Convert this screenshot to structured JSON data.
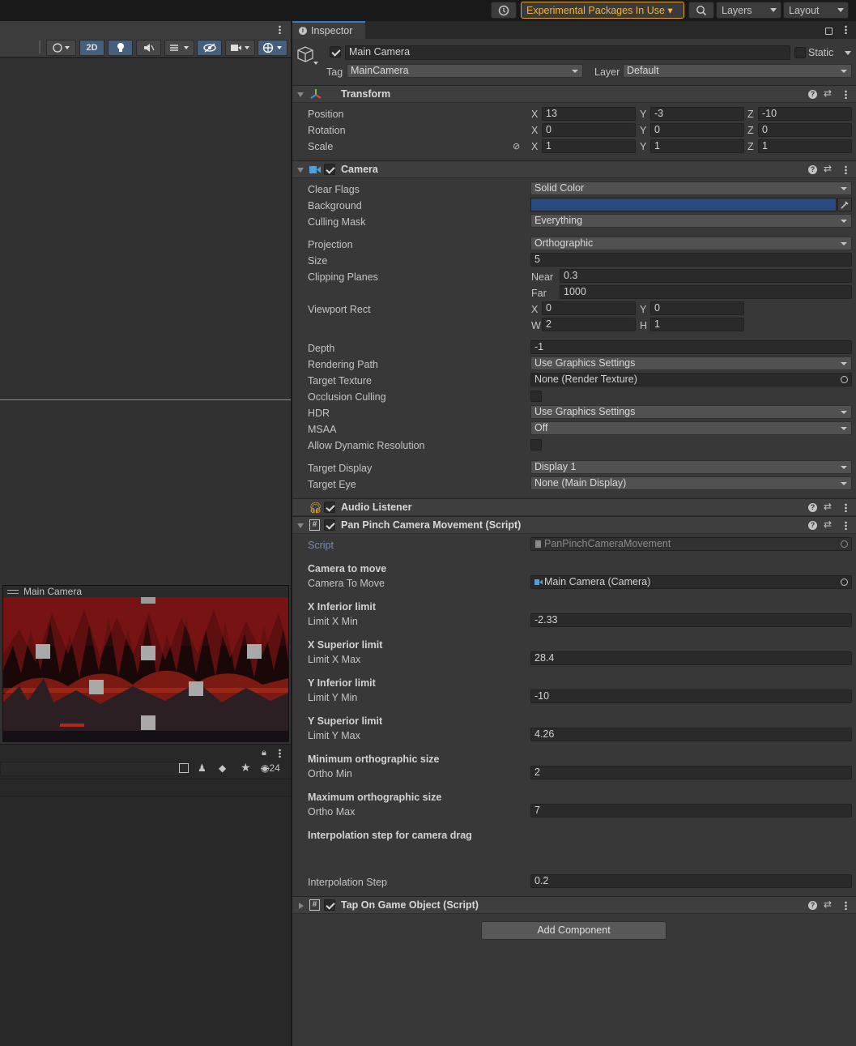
{
  "topbar": {
    "experimental": "Experimental Packages In Use ▾",
    "layers": "Layers",
    "layout": "Layout"
  },
  "scene": {
    "mode_2d": "2D",
    "hidden_count": "24",
    "preview_title": "Main Camera"
  },
  "inspector": {
    "tab": "Inspector",
    "object_name": "Main Camera",
    "static_label": "Static",
    "tag_label": "Tag",
    "tag_value": "MainCamera",
    "layer_label": "Layer",
    "layer_value": "Default",
    "transform": {
      "title": "Transform",
      "position_label": "Position",
      "rotation_label": "Rotation",
      "scale_label": "Scale",
      "position": {
        "x": "13",
        "y": "-3",
        "z": "-10"
      },
      "rotation": {
        "x": "0",
        "y": "0",
        "z": "0"
      },
      "scale": {
        "x": "1",
        "y": "1",
        "z": "1"
      }
    },
    "camera": {
      "title": "Camera",
      "clear_flags_label": "Clear Flags",
      "clear_flags": "Solid Color",
      "background_label": "Background",
      "background_color": "#2a4a80",
      "culling_mask_label": "Culling Mask",
      "culling_mask": "Everything",
      "projection_label": "Projection",
      "projection": "Orthographic",
      "size_label": "Size",
      "size": "5",
      "clipping_label": "Clipping Planes",
      "near_label": "Near",
      "near": "0.3",
      "far_label": "Far",
      "far": "1000",
      "viewport_label": "Viewport Rect",
      "vp_x": "0",
      "vp_y": "0",
      "vp_w": "2",
      "vp_h": "1",
      "depth_label": "Depth",
      "depth": "-1",
      "rendering_path_label": "Rendering Path",
      "rendering_path": "Use Graphics Settings",
      "target_texture_label": "Target Texture",
      "target_texture": "None (Render Texture)",
      "occlusion_label": "Occlusion Culling",
      "hdr_label": "HDR",
      "hdr": "Use Graphics Settings",
      "msaa_label": "MSAA",
      "msaa": "Off",
      "dynres_label": "Allow Dynamic Resolution",
      "target_display_label": "Target Display",
      "target_display": "Display 1",
      "target_eye_label": "Target Eye",
      "target_eye": "None (Main Display)"
    },
    "audio_listener": {
      "title": "Audio Listener"
    },
    "pan_pinch": {
      "title": "Pan Pinch Camera Movement (Script)",
      "script_label": "Script",
      "script_value": "PanPinchCameraMovement",
      "h_camera": "Camera to move",
      "camera_to_move_label": "Camera To Move",
      "camera_to_move": "Main Camera (Camera)",
      "h_xinf": "X Inferior limit",
      "limit_x_min_label": "Limit X Min",
      "limit_x_min": "-2.33",
      "h_xsup": "X Superior limit",
      "limit_x_max_label": "Limit X Max",
      "limit_x_max": "28.4",
      "h_yinf": "Y Inferior limit",
      "limit_y_min_label": "Limit Y Min",
      "limit_y_min": "-10",
      "h_ysup": "Y Superior limit",
      "limit_y_max_label": "Limit Y Max",
      "limit_y_max": "4.26",
      "h_omin": "Minimum orthographic size",
      "ortho_min_label": "Ortho Min",
      "ortho_min": "2",
      "h_omax": "Maximum orthographic size",
      "ortho_max_label": "Ortho Max",
      "ortho_max": "7",
      "h_interp": "Interpolation step for camera drag",
      "interp_label": "Interpolation Step",
      "interp": "0.2"
    },
    "tap": {
      "title": "Tap On Game Object (Script)"
    },
    "add_component": "Add Component"
  },
  "axes": {
    "x": "X",
    "y": "Y",
    "z": "Z",
    "w": "W",
    "h": "H"
  }
}
